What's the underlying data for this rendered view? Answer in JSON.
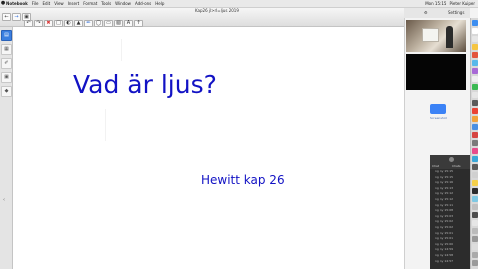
{
  "menubar": {
    "app_name": "Notebook",
    "items": [
      "File",
      "Edit",
      "View",
      "Insert",
      "Format",
      "Tools",
      "Window",
      "Add-ons",
      "Help"
    ],
    "clock": "Mon 15:15",
    "user": "Pieter Kuiper"
  },
  "window": {
    "title": "Kap26 jl>rl=ljus 2019"
  },
  "toolbar": {
    "row1": [
      "←",
      "→",
      "▣",
      "✎",
      "▧",
      "✓",
      "✖",
      "■",
      "▤"
    ],
    "row2": [
      "↶",
      "↷",
      "✂",
      "⎙",
      "□",
      "◐",
      "▲",
      "✏",
      "◯",
      "▭",
      "A",
      "↑"
    ]
  },
  "sidebar": {
    "buttons": [
      {
        "name": "page-sorter",
        "glyph": "▤",
        "active": true
      },
      {
        "name": "gallery",
        "glyph": "▦",
        "active": false
      },
      {
        "name": "attachments",
        "glyph": "✐",
        "active": false
      },
      {
        "name": "properties",
        "glyph": "▣",
        "active": false
      },
      {
        "name": "addons",
        "glyph": "◆",
        "active": false
      }
    ],
    "collapse_glyph": "‹"
  },
  "slide": {
    "title": "Vad är ljus?",
    "subtitle": "Hewitt kap 26"
  },
  "right_panel": {
    "settings_label": "Settings",
    "mid_label": "Screenshot",
    "chat_tabs": [
      "Chat",
      "Chats"
    ],
    "chat_entries": [
      "ng ny 15:15",
      "ng ny 15:15",
      "ng ny 15:16",
      "ng ny 15:13",
      "ng ny 15:12",
      "ng ny 15:12",
      "ng ny 15:11",
      "ng ny 15:08",
      "ng ny 15:03",
      "ng ny 15:02",
      "ng ny 15:02",
      "ng ny 15:01",
      "ng ny 15:01",
      "ng ny 15:00",
      "ng ny 14:59",
      "ng ny 14:58",
      "ng ny 14:57"
    ]
  },
  "dock": {
    "icon_colors": [
      "#3d8ef0",
      "#ffffff",
      "#e6e6e6",
      "#f5c542",
      "#e3543d",
      "#58b8ea",
      "#a86ad6",
      "#f0f0f0",
      "#3cba54",
      "#e6e6e6",
      "#5a5a5a",
      "#ea4335",
      "#f2a33a",
      "#4a90e2",
      "#d64541",
      "#7a7a7a",
      "#e84c8b",
      "#3aa7d8",
      "#5c5c5c",
      "#d0d0d0",
      "#f5d04a",
      "#2b2b2b",
      "#7ec8e3",
      "#c0c0c0",
      "#4c4c4c",
      "#e6e6e6",
      "#bbbbbb",
      "#999999",
      "#dddddd",
      "#aaaaaa"
    ]
  },
  "colors": {
    "slide_text": "#1212c4",
    "accent": "#3b7fe0"
  }
}
